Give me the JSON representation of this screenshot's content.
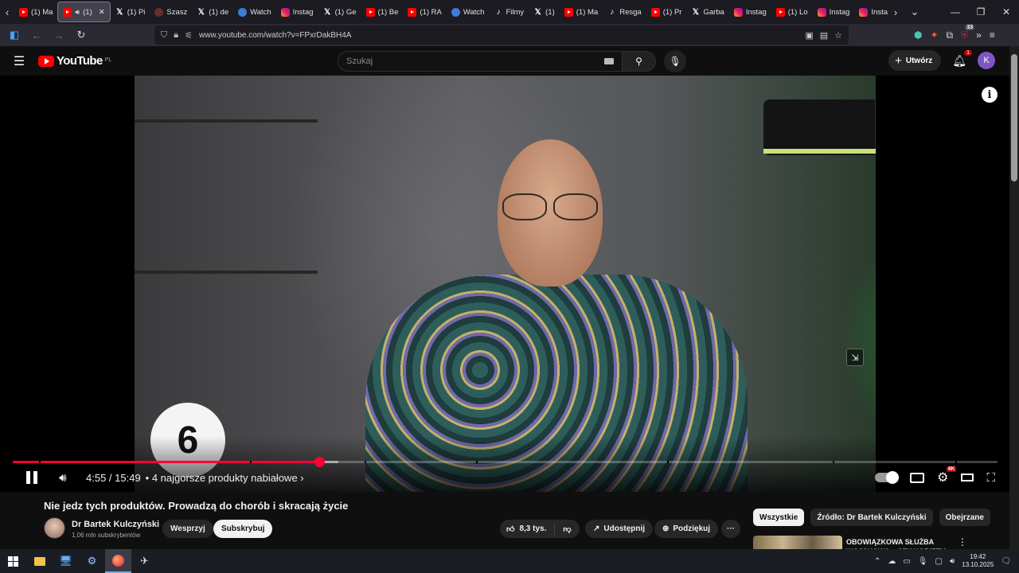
{
  "browser": {
    "tabs": [
      {
        "label": "(1) Ma",
        "icon": "youtube-icon",
        "active": false
      },
      {
        "label": "(1)",
        "icon": "youtube-icon",
        "active": true,
        "audio": true
      },
      {
        "label": "(1) Pi",
        "icon": "x-icon",
        "active": false
      },
      {
        "label": "Szasz",
        "icon": "site-icon",
        "active": false
      },
      {
        "label": "(1) de",
        "icon": "x-icon",
        "active": false
      },
      {
        "label": "Watch",
        "icon": "watch-icon",
        "active": false
      },
      {
        "label": "Instag",
        "icon": "instagram-icon",
        "active": false
      },
      {
        "label": "(1) Ge",
        "icon": "x-icon",
        "active": false
      },
      {
        "label": "(1) Be",
        "icon": "youtube-icon",
        "active": false
      },
      {
        "label": "(1) RA",
        "icon": "youtube-icon",
        "active": false
      },
      {
        "label": "Watch",
        "icon": "watch-icon",
        "active": false
      },
      {
        "label": "Filmy",
        "icon": "tiktok-icon",
        "active": false
      },
      {
        "label": "(1)",
        "icon": "x-icon",
        "active": false
      },
      {
        "label": "(1) Ma",
        "icon": "youtube-icon",
        "active": false
      },
      {
        "label": "Resga",
        "icon": "tiktok-icon",
        "active": false
      },
      {
        "label": "(1) Pr",
        "icon": "youtube-icon",
        "active": false
      },
      {
        "label": "Garba",
        "icon": "x-icon",
        "active": false
      },
      {
        "label": "Instag",
        "icon": "instagram-icon",
        "active": false
      },
      {
        "label": "(1) Lo",
        "icon": "youtube-icon",
        "active": false
      },
      {
        "label": "Instag",
        "icon": "instagram-icon",
        "active": false
      },
      {
        "label": "Insta",
        "icon": "instagram-icon",
        "active": false
      }
    ],
    "url": "www.youtube.com/watch?v=FPxrDakBH4A",
    "extension_badge": "33"
  },
  "youtube": {
    "logo_text": "YouTube",
    "logo_country": "PL",
    "search_placeholder": "Szukaj",
    "create_label": "Utwórz",
    "notifications_count": "1",
    "avatar_letter": "K"
  },
  "player": {
    "chapter_number": "6",
    "current_time": "4:55",
    "duration": "15:49",
    "time_display": "4:55 / 15:49",
    "chapter_title": "• 4 najgorsze produkty nabiałowe ›",
    "played_fraction": 0.311,
    "buffered_fraction": 0.331,
    "quality_badge": "4K"
  },
  "video": {
    "title": "Nie jedz tych produktów. Prowadzą do chorób i skracają życie",
    "channel_name": "Dr Bartek Kulczyński",
    "subscribers": "1,06 mln subskrybentów",
    "join_label": "Wesprzyj",
    "subscribe_label": "Subskrybuj",
    "likes": "8,3 tys.",
    "share_label": "Udostępnij",
    "thanks_label": "Podziękuj",
    "more_label": "···"
  },
  "sidebar": {
    "chips": [
      "Wszystkie",
      "Źródło: Dr Bartek Kulczyński",
      "Obejrzane"
    ],
    "rec_title": "OBOWIĄZKOWA SŁUŻBA WOJSKOWA – CZY KOBIETY"
  },
  "taskbar": {
    "time": "19:42",
    "date": "13.10.2025"
  }
}
